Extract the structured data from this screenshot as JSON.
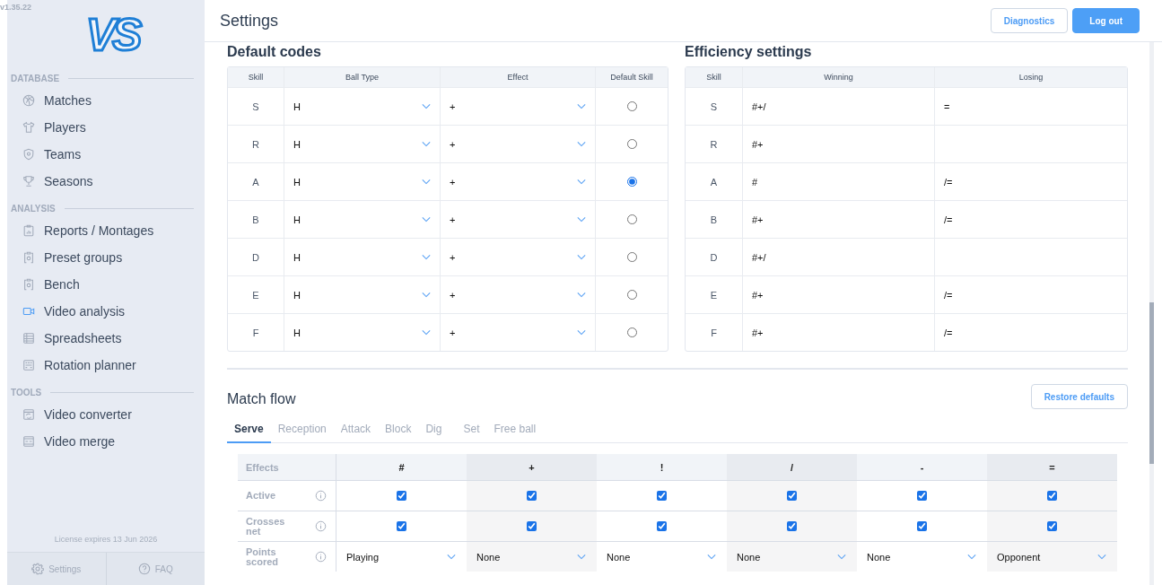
{
  "version": "v1.35.22",
  "logo": "VS",
  "sidebar": {
    "sections": [
      {
        "heading": "DATABASE",
        "items": [
          {
            "label": "Matches",
            "active": false
          },
          {
            "label": "Players",
            "active": false
          },
          {
            "label": "Teams",
            "active": false
          },
          {
            "label": "Seasons",
            "active": false
          }
        ]
      },
      {
        "heading": "ANALYSIS",
        "items": [
          {
            "label": "Reports / Montages",
            "active": false
          },
          {
            "label": "Preset groups",
            "active": false
          },
          {
            "label": "Bench",
            "active": false
          },
          {
            "label": "Video analysis",
            "active": true
          },
          {
            "label": "Spreadsheets",
            "active": false
          },
          {
            "label": "Rotation planner",
            "active": false
          }
        ]
      },
      {
        "heading": "TOOLS",
        "items": [
          {
            "label": "Video converter",
            "active": false
          },
          {
            "label": "Video merge",
            "active": false
          }
        ]
      }
    ],
    "license": "License expires 13 Jun 2026",
    "footer": [
      {
        "label": "Settings"
      },
      {
        "label": "FAQ"
      }
    ]
  },
  "header": {
    "title": "Settings",
    "buttons": [
      {
        "label": "Diagnostics",
        "kind": "outline"
      },
      {
        "label": "Log out",
        "kind": "primary"
      }
    ]
  },
  "default_codes": {
    "title": "Default codes",
    "columns": [
      "Skill",
      "Ball Type",
      "Effect",
      "Default Skill"
    ],
    "rows": [
      {
        "skill": "S",
        "ball_type": "H",
        "effect": "+",
        "selected": false
      },
      {
        "skill": "R",
        "ball_type": "H",
        "effect": "+",
        "selected": false
      },
      {
        "skill": "A",
        "ball_type": "H",
        "effect": "+",
        "selected": true
      },
      {
        "skill": "B",
        "ball_type": "H",
        "effect": "+",
        "selected": false
      },
      {
        "skill": "D",
        "ball_type": "H",
        "effect": "+",
        "selected": false
      },
      {
        "skill": "E",
        "ball_type": "H",
        "effect": "+",
        "selected": false
      },
      {
        "skill": "F",
        "ball_type": "H",
        "effect": "+",
        "selected": false
      }
    ]
  },
  "efficiency": {
    "title": "Efficiency settings",
    "columns": [
      "Skill",
      "Winning",
      "Losing"
    ],
    "rows": [
      {
        "skill": "S",
        "winning": "#+/",
        "losing": "="
      },
      {
        "skill": "R",
        "winning": "#+"
      },
      {
        "skill": "A",
        "winning": "#",
        "losing": "/="
      },
      {
        "skill": "B",
        "winning": "#+",
        "losing": "/="
      },
      {
        "skill": "D",
        "winning": "#+/"
      },
      {
        "skill": "E",
        "winning": "#+",
        "losing": "/="
      },
      {
        "skill": "F",
        "winning": "#+",
        "losing": "/="
      }
    ]
  },
  "match_flow": {
    "title": "Match flow",
    "restore_button": "Restore defaults",
    "tabs": [
      {
        "label": "Serve",
        "selected": true
      },
      {
        "label": "Reception",
        "selected": false
      },
      {
        "label": "Attack",
        "selected": false
      },
      {
        "label": "Block",
        "selected": false
      },
      {
        "label": "Dig",
        "selected": false
      },
      {
        "label": "Set",
        "selected": false
      },
      {
        "label": "Free ball",
        "selected": false
      }
    ],
    "table": {
      "corner": "Effects",
      "columns": [
        "#",
        "+",
        "!",
        "/",
        "-",
        "="
      ],
      "rows": [
        {
          "label": "Active",
          "kind": "checkbox",
          "cells": [
            {
              "checked": true
            },
            {
              "checked": true
            },
            {
              "checked": true
            },
            {
              "checked": true
            },
            {
              "checked": true
            },
            {
              "checked": true
            }
          ]
        },
        {
          "label": "Crosses net",
          "kind": "checkbox",
          "cells": [
            {
              "checked": true
            },
            {
              "checked": true
            },
            {
              "checked": true
            },
            {
              "checked": true
            },
            {
              "checked": true
            },
            {
              "checked": true
            }
          ]
        },
        {
          "label": "Points scored",
          "kind": "select",
          "cells": [
            {
              "value": "Playing"
            },
            {
              "value": "None"
            },
            {
              "value": "None"
            },
            {
              "value": "None"
            },
            {
              "value": "None"
            },
            {
              "value": "Opponent"
            }
          ]
        }
      ]
    }
  }
}
